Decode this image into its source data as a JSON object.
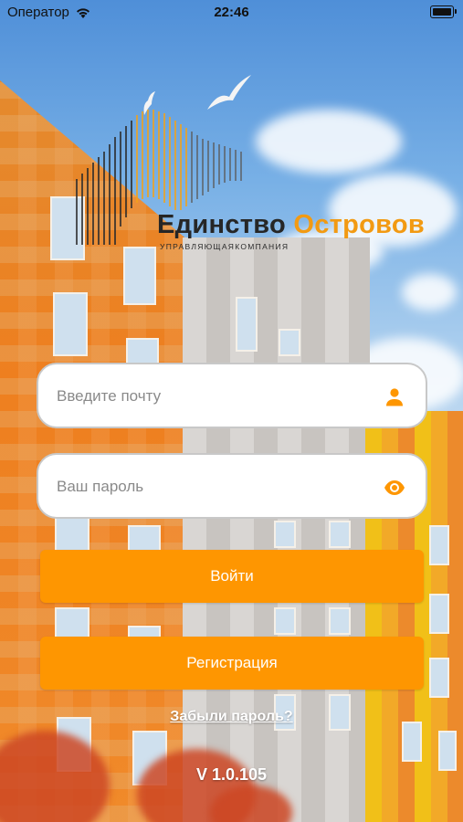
{
  "status_bar": {
    "carrier": "Оператор",
    "time": "22:46",
    "icons": [
      "wifi-icon",
      "battery-icon"
    ]
  },
  "logo": {
    "word1": "Единство",
    "word2": "Островов",
    "subtitle": "УПРАВЛЯЮЩАЯКОМПАНИЯ"
  },
  "form": {
    "email_placeholder": "Введите почту",
    "email_value": "",
    "email_icon": "user-icon",
    "password_placeholder": "Ваш пароль",
    "password_value": "",
    "password_icon": "eye-icon",
    "login_label": "Войти",
    "register_label": "Регистрация",
    "forgot_label": "Забыли пароль?"
  },
  "version": "V 1.0.105",
  "colors": {
    "accent": "#fe9601",
    "logo_dark": "#262626",
    "logo_orange": "#f29a12"
  }
}
